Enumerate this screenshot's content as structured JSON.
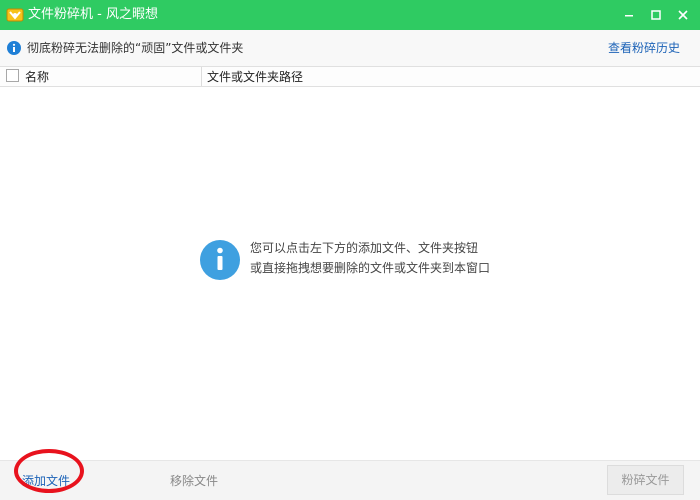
{
  "window": {
    "title": "文件粉碎机 - 风之暇想",
    "accent_color": "#2fcb62",
    "app_icon": "shredder-app-icon",
    "controls": [
      "minimize-icon",
      "maximize-icon",
      "close-icon"
    ]
  },
  "infobar": {
    "icon": "info-icon",
    "text": "彻底粉碎无法删除的“顽固”文件或文件夹",
    "history_link": "查看粉碎历史"
  },
  "table": {
    "columns": [
      "名称",
      "文件或文件夹路径"
    ],
    "rows": []
  },
  "empty_state": {
    "icon": "info-icon",
    "line1": "您可以点击左下方的添加文件、文件夹按钮",
    "line2": "或直接拖拽想要删除的文件或文件夹到本窗口"
  },
  "toolbar": {
    "add_file": "添加文件",
    "remove_file": "移除文件",
    "shred_file": "粉碎文件"
  }
}
